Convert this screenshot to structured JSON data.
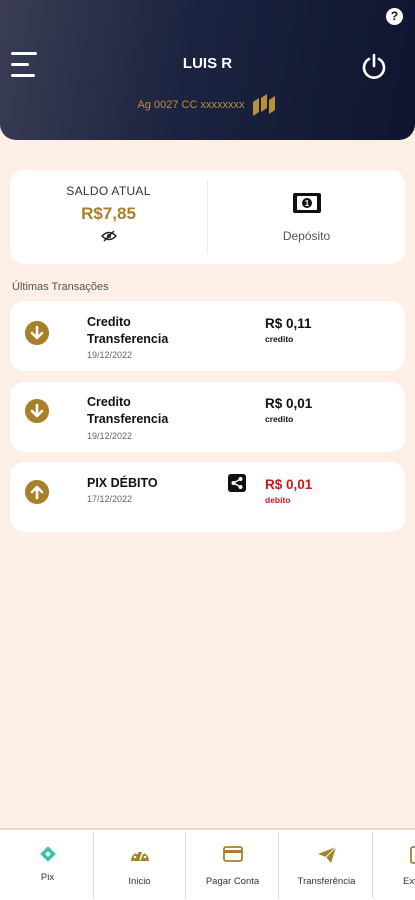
{
  "header": {
    "user_name": "LUIS R",
    "account": "Ag 0027 CC xxxxxxxx",
    "help_icon": "question-circle-icon",
    "menu_icon": "hamburger-menu-icon",
    "power_icon": "power-icon"
  },
  "balance": {
    "label": "SALDO ATUAL",
    "value": "R$7,85",
    "visibility_icon": "eye-slash-icon"
  },
  "deposit": {
    "label": "Depósito",
    "icon": "banknote-icon"
  },
  "transactions_title": "Últimas Transações",
  "transactions": [
    {
      "title": "Credito Transferencia",
      "date": "19/12/2022",
      "amount": "R$ 0,11",
      "kind": "credito",
      "direction": "in"
    },
    {
      "title": "Credito Transferencia",
      "date": "19/12/2022",
      "amount": "R$ 0,01",
      "kind": "credito",
      "direction": "in"
    },
    {
      "title": "PIX DÉBITO",
      "date": "17/12/2022",
      "amount": "R$ 0,01",
      "kind": "debito",
      "direction": "out"
    }
  ],
  "nav": [
    {
      "label": "Pix",
      "icon": "pix-icon"
    },
    {
      "label": "Inicio",
      "icon": "speedometer-icon"
    },
    {
      "label": "Pagar Conta",
      "icon": "credit-card-icon"
    },
    {
      "label": "Transferência",
      "icon": "paper-plane-icon"
    },
    {
      "label": "Ext",
      "icon": "extract-icon"
    }
  ],
  "colors": {
    "header_bg": "#1c2340",
    "accent_gold": "#a8802a",
    "debit_red": "#c81a1a",
    "page_bg": "#fdeee6",
    "pix_teal": "#3dbfa8"
  }
}
